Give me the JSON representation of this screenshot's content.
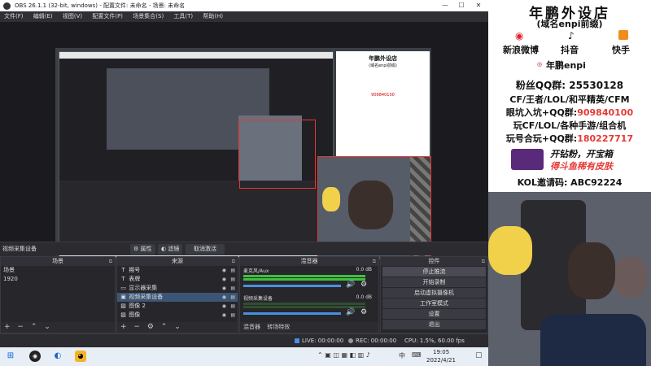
{
  "window": {
    "title": "OBS 26.1.1 (32-bit, windows) - 配置文件: 未命名 - 场景: 未命名",
    "minimize": "—",
    "maximize": "☐",
    "close": "✕"
  },
  "menu": [
    "文件(F)",
    "编辑(E)",
    "视图(V)",
    "配置文件(P)",
    "场景集合(S)",
    "工具(T)",
    "帮助(H)"
  ],
  "source_bar": {
    "current_source": "视频采集设备",
    "properties": "属性",
    "filters": "滤镜",
    "deactivate": "取消激活"
  },
  "scenes": {
    "header": "场景",
    "items": [
      "场景",
      "1920"
    ]
  },
  "sources": {
    "header": "来源",
    "items": [
      {
        "icon": "T",
        "name": "期号"
      },
      {
        "icon": "T",
        "name": "表牌"
      },
      {
        "icon": "▭",
        "name": "显示器采集"
      },
      {
        "icon": "▣",
        "name": "视频采集设备"
      },
      {
        "icon": "▨",
        "name": "图像 2"
      },
      {
        "icon": "▨",
        "name": "图像"
      }
    ]
  },
  "mixer": {
    "header": "混音器",
    "channels": [
      {
        "name": "麦克风/Aux",
        "db": "0.0 dB"
      },
      {
        "name": "视频采集设备",
        "db": "0.0 dB"
      }
    ],
    "tabs": [
      "混音器",
      "转场特效"
    ]
  },
  "controls": {
    "header": "控件",
    "buttons": [
      "停止推流",
      "开始录制",
      "启动虚拟摄像机",
      "工作室模式",
      "设置",
      "退出"
    ]
  },
  "status": {
    "live": "LIVE: 00:00:00",
    "rec": "REC: 00:00:00",
    "cpu": "CPU: 1.5%, 60.00 fps"
  },
  "taskbar": {
    "time": "19:05",
    "date": "2022/4/21",
    "ime": "中"
  },
  "ad": {
    "title": "年鹏外设店",
    "subtitle": "(域名enpi前缀)",
    "weibo": "新浪微博",
    "douyin": "抖音",
    "kuaishou": "快手",
    "brand": "年鹏enpi",
    "fans_label": "粉丝QQ群:",
    "fans_group": "25530128",
    "line1": "CF/王者/LOL/和平精英/CFM",
    "line2_label": "眼坑入坑+QQ群:",
    "line2_num": "909840100",
    "line3": "玩CF/LOL/各种手游/组合机",
    "line4_label": "玩号合玩+QQ群:",
    "line4_num": "180227717",
    "promo1": "开钻粉，开宝箱",
    "promo2": "得斗鱼稀有皮肤",
    "kol": "KOL邀请码: ABC92224"
  },
  "colors": {
    "accent_red": "#e53935",
    "selection": "#3c5574",
    "meter_green": "#3fbf3f"
  }
}
